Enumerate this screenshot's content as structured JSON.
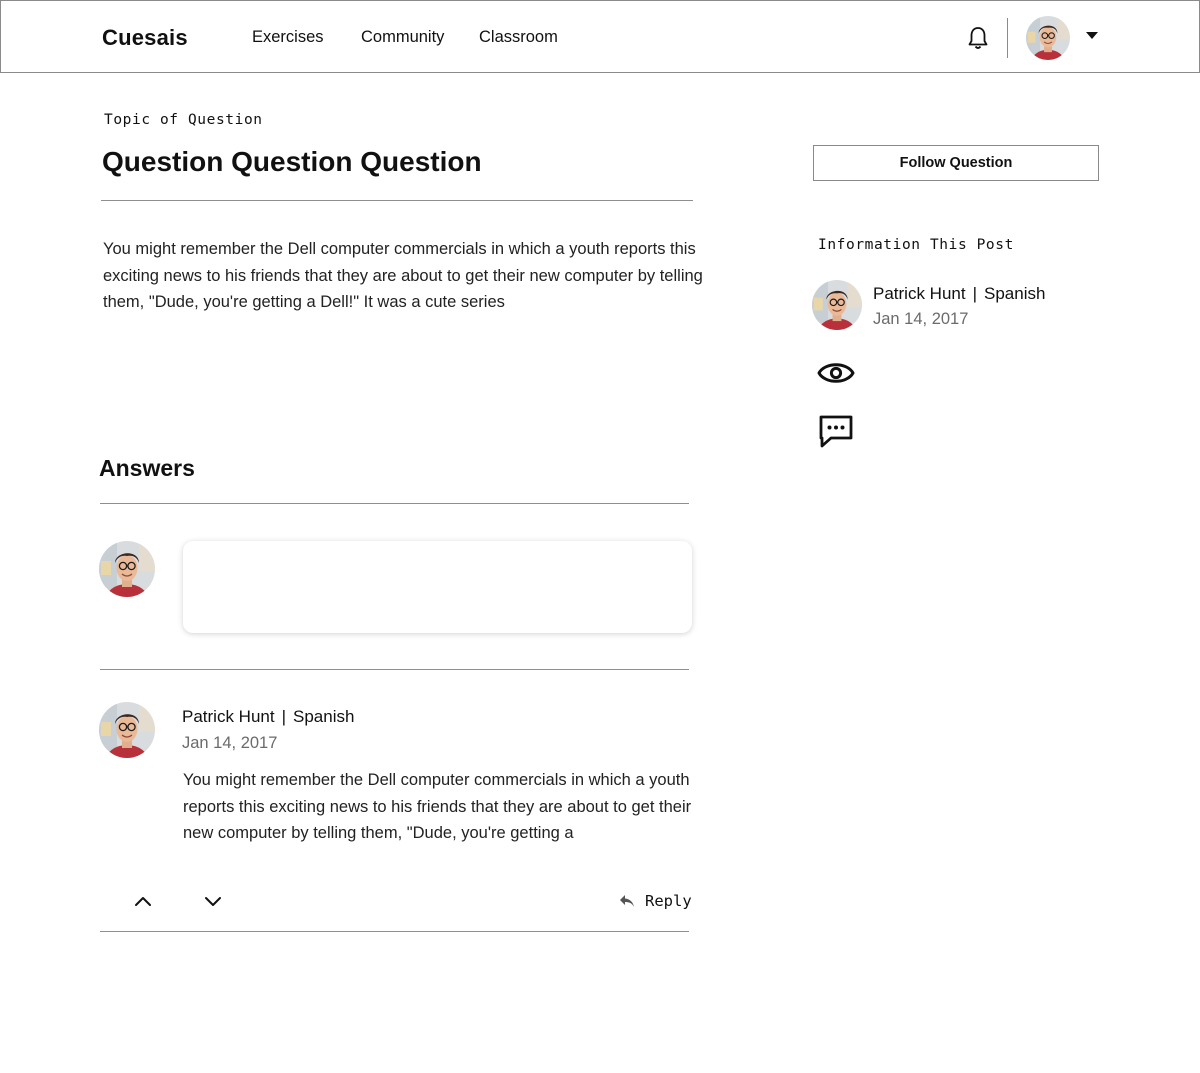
{
  "nav": {
    "brand": "Cuesais",
    "links": [
      "Exercises",
      "Community",
      "Classroom"
    ]
  },
  "question": {
    "topic": "Topic of Question",
    "title": "Question Question Question",
    "body": "You might remember the Dell computer commercials in which a youth reports this exciting news to his friends that they are about to get their new computer by telling them, \"Dude, you're getting a Dell!\" It was a cute series"
  },
  "answers": {
    "heading": "Answers",
    "input_placeholder": "",
    "items": [
      {
        "author": "Patrick Hunt",
        "language": "Spanish",
        "separator": "|",
        "date": "Jan 14, 2017",
        "body": "You might remember the Dell computer commercials in which a youth reports this exciting news to his friends that they are about to get their new computer by telling them, \"Dude, you're getting a",
        "reply_label": "Reply"
      }
    ]
  },
  "sidebar": {
    "follow_label": "Follow Question",
    "info_heading": "Information This Post",
    "author": "Patrick Hunt",
    "separator": "|",
    "language": "Spanish",
    "date": "Jan 14, 2017"
  },
  "icons": {
    "notifications": "bell-icon",
    "account_menu": "caret-down-icon",
    "views": "eye-icon",
    "comments": "chat-bubble-icon",
    "upvote": "chevron-up-icon",
    "downvote": "chevron-down-icon",
    "reply": "reply-arrow-icon"
  },
  "colors": {
    "text": "#111111",
    "muted": "#6b6b6b",
    "divider": "#8f8f8f",
    "background": "#ffffff"
  }
}
